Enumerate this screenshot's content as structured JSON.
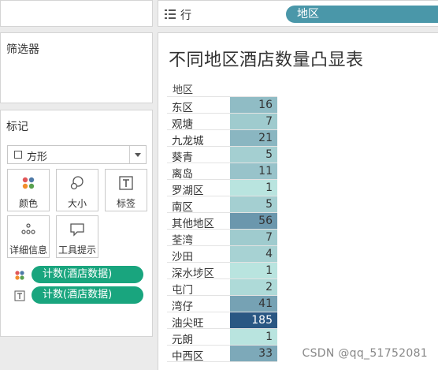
{
  "shelves": {
    "rows_label": "行",
    "rows_pill": "地区"
  },
  "filters": {
    "title": "筛选器"
  },
  "marks": {
    "title": "标记",
    "mark_type": "方形",
    "buttons": {
      "color": "颜色",
      "size": "大小",
      "label": "标签",
      "detail": "详细信息",
      "tooltip": "工具提示"
    },
    "pills": [
      {
        "label": "计数(酒店数据)",
        "encoding": "color"
      },
      {
        "label": "计数(酒店数据)",
        "encoding": "label"
      }
    ]
  },
  "view": {
    "title": "不同地区酒店数量凸显表",
    "column_header": "地区",
    "color_scale": {
      "min_color": "#b9e4df",
      "max_color": "#2a5783"
    },
    "rows": [
      {
        "name": "东区",
        "value": 16
      },
      {
        "name": "观塘",
        "value": 7
      },
      {
        "name": "九龙城",
        "value": 21
      },
      {
        "name": "葵青",
        "value": 5
      },
      {
        "name": "离岛",
        "value": 11
      },
      {
        "name": "罗湖区",
        "value": 1
      },
      {
        "name": "南区",
        "value": 5
      },
      {
        "name": "其他地区",
        "value": 56
      },
      {
        "name": "荃湾",
        "value": 7
      },
      {
        "name": "沙田",
        "value": 4
      },
      {
        "name": "深水埗区",
        "value": 1
      },
      {
        "name": "屯门",
        "value": 2
      },
      {
        "name": "湾仔",
        "value": 41
      },
      {
        "name": "油尖旺",
        "value": 185
      },
      {
        "name": "元朗",
        "value": 1
      },
      {
        "name": "中西区",
        "value": 33
      }
    ]
  },
  "watermark": "CSDN @qq_51752081"
}
